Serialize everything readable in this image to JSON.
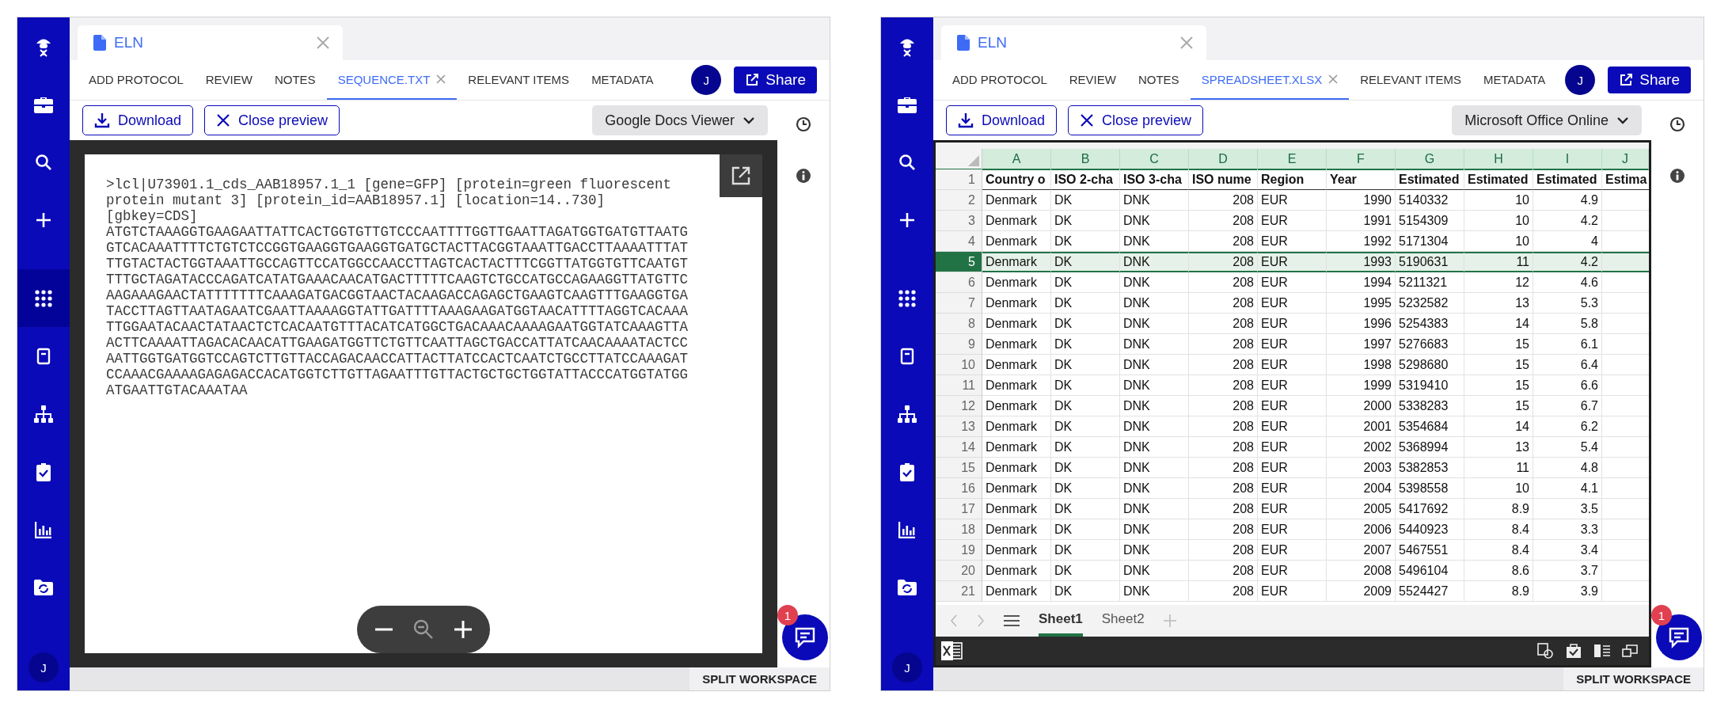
{
  "panels": [
    {
      "kind": "text",
      "sidebar": {
        "items": [
          {
            "kind": "logo",
            "selected": false
          },
          {
            "kind": "briefcase",
            "selected": false
          },
          {
            "kind": "search",
            "selected": false
          },
          {
            "kind": "plus",
            "selected": false
          },
          {
            "kind": "grid",
            "selected": true
          },
          {
            "kind": "tablet",
            "selected": false
          },
          {
            "kind": "hierarchy",
            "selected": false
          },
          {
            "kind": "clipboard",
            "selected": false
          },
          {
            "kind": "chart",
            "selected": false
          },
          {
            "kind": "folder",
            "selected": false
          }
        ],
        "avatar": "J"
      },
      "doc_tab": {
        "title": "ELN"
      },
      "nav_tabs": [
        {
          "label": "ADD PROTOCOL",
          "selected": false,
          "closable": false
        },
        {
          "label": "REVIEW",
          "selected": false,
          "closable": false
        },
        {
          "label": "NOTES",
          "selected": false,
          "closable": false
        },
        {
          "label": "SEQUENCE.TXT",
          "selected": true,
          "closable": true
        },
        {
          "label": "RELEVANT ITEMS",
          "selected": false,
          "closable": false
        },
        {
          "label": "METADATA",
          "selected": false,
          "closable": false
        }
      ],
      "user_avatar": "J",
      "share": "Share",
      "toolbar": {
        "download": "Download",
        "close_preview": "Close preview",
        "viewer": "Google Docs Viewer"
      },
      "viewer": {
        "lines": [
          ">lcl|U73901.1_cds_AAB18957.1_1 [gene=GFP] [protein=green fluorescent",
          "protein mutant 3] [protein_id=AAB18957.1] [location=14..730]",
          "[gbkey=CDS]",
          "ATGTCTAAAGGTGAAGAATTATTCACTGGTGTTGTCCCAATTTTGGTTGAATTAGATGGTGATGTTAATG",
          "GTCACAAATTTTCTGTCTCCGGTGAAGGTGAAGGTGATGCTACTTACGGTAAATTGACCTTAAAATTTAT",
          "TTGTACTACTGGTAAATTGCCAGTTCCATGGCCAACCTTAGTCACTACTTTCGGTTATGGTGTTCAATGT",
          "TTTGCTAGATACCCAGATCATATGAAACAACATGACTTTTTCAAGTCTGCCATGCCAGAAGGTTATGTTC",
          "AAGAAAGAACTATTTTTTTCAAAGATGACGGTAACTACAAGACCAGAGCTGAAGTCAAGTTTGAAGGTGA",
          "TACCTTAGTTAATAGAATCGAATTAAAAGGTATTGATTTTAAAGAAGATGGTAACATTTTAGGTCACAAA",
          "TTGGAATACAACTATAACTCTCACAATGTTTACATCATGGCTGACAAACAAAAGAATGGTATCAAAGTTA",
          "ACTTCAAAATTAGACACAACATTGAAGATGGTTCTGTTCAATTAGCTGACCATTATCAACAAAATACTCC",
          "AATTGGTGATGGTCCAGTCTTGTTACCAGACAACCATTACTTATCCACTCAATCTGCCTTATCCAAAGAT",
          "CCAAACGAAAAGAGAGACCACATGGTCTTGTTAGAATTTGTTACTGCTGCTGGTATTACCCATGGTATGG",
          "ATGAATTGTACAAATAA"
        ]
      },
      "chat_badge": "1",
      "split": "SPLIT WORKSPACE"
    },
    {
      "kind": "sheet",
      "sidebar": {
        "items": [
          {
            "kind": "logo",
            "selected": false
          },
          {
            "kind": "briefcase",
            "selected": false
          },
          {
            "kind": "search",
            "selected": false
          },
          {
            "kind": "plus",
            "selected": false
          },
          {
            "kind": "grid",
            "selected": false
          },
          {
            "kind": "tablet",
            "selected": false
          },
          {
            "kind": "hierarchy",
            "selected": false
          },
          {
            "kind": "clipboard",
            "selected": false
          },
          {
            "kind": "chart",
            "selected": false
          },
          {
            "kind": "folder",
            "selected": false
          }
        ],
        "avatar": "J"
      },
      "doc_tab": {
        "title": "ELN"
      },
      "nav_tabs": [
        {
          "label": "ADD PROTOCOL",
          "selected": false,
          "closable": false
        },
        {
          "label": "REVIEW",
          "selected": false,
          "closable": false
        },
        {
          "label": "NOTES",
          "selected": false,
          "closable": false
        },
        {
          "label": "SPREADSHEET.XLSX",
          "selected": true,
          "closable": true
        },
        {
          "label": "RELEVANT ITEMS",
          "selected": false,
          "closable": false
        },
        {
          "label": "METADATA",
          "selected": false,
          "closable": false
        }
      ],
      "user_avatar": "J",
      "share": "Share",
      "toolbar": {
        "download": "Download",
        "close_preview": "Close preview",
        "viewer": "Microsoft Office Online"
      },
      "viewer": {
        "columns": [
          {
            "letter": "A",
            "numeric": false
          },
          {
            "letter": "B",
            "numeric": false
          },
          {
            "letter": "C",
            "numeric": false
          },
          {
            "letter": "D",
            "numeric": true
          },
          {
            "letter": "E",
            "numeric": false
          },
          {
            "letter": "F",
            "numeric": true
          },
          {
            "letter": "G",
            "numeric": false
          },
          {
            "letter": "H",
            "numeric": true
          },
          {
            "letter": "I",
            "numeric": true
          },
          {
            "letter": "J",
            "numeric": false
          }
        ],
        "rows": [
          {
            "number": "1",
            "selected": false,
            "header": true,
            "cells": [
              "Country o",
              "ISO 2-cha",
              "ISO 3-cha",
              "ISO nume",
              "Region",
              "Year",
              "Estimated",
              "Estimated",
              "Estimated",
              "Estima"
            ]
          },
          {
            "number": "2",
            "selected": false,
            "header": false,
            "cells": [
              "Denmark",
              "DK",
              "DNK",
              "208",
              "EUR",
              "1990",
              "5140332",
              "10",
              "4.9"
            ]
          },
          {
            "number": "3",
            "selected": false,
            "header": false,
            "cells": [
              "Denmark",
              "DK",
              "DNK",
              "208",
              "EUR",
              "1991",
              "5154309",
              "10",
              "4.2"
            ]
          },
          {
            "number": "4",
            "selected": false,
            "header": false,
            "cells": [
              "Denmark",
              "DK",
              "DNK",
              "208",
              "EUR",
              "1992",
              "5171304",
              "10",
              "4"
            ]
          },
          {
            "number": "5",
            "selected": true,
            "header": false,
            "cells": [
              "Denmark",
              "DK",
              "DNK",
              "208",
              "EUR",
              "1993",
              "5190631",
              "11",
              "4.2"
            ]
          },
          {
            "number": "6",
            "selected": false,
            "header": false,
            "cells": [
              "Denmark",
              "DK",
              "DNK",
              "208",
              "EUR",
              "1994",
              "5211321",
              "12",
              "4.6"
            ]
          },
          {
            "number": "7",
            "selected": false,
            "header": false,
            "cells": [
              "Denmark",
              "DK",
              "DNK",
              "208",
              "EUR",
              "1995",
              "5232582",
              "13",
              "5.3"
            ]
          },
          {
            "number": "8",
            "selected": false,
            "header": false,
            "cells": [
              "Denmark",
              "DK",
              "DNK",
              "208",
              "EUR",
              "1996",
              "5254383",
              "14",
              "5.8"
            ]
          },
          {
            "number": "9",
            "selected": false,
            "header": false,
            "cells": [
              "Denmark",
              "DK",
              "DNK",
              "208",
              "EUR",
              "1997",
              "5276683",
              "15",
              "6.1"
            ]
          },
          {
            "number": "10",
            "selected": false,
            "header": false,
            "cells": [
              "Denmark",
              "DK",
              "DNK",
              "208",
              "EUR",
              "1998",
              "5298680",
              "15",
              "6.4"
            ]
          },
          {
            "number": "11",
            "selected": false,
            "header": false,
            "cells": [
              "Denmark",
              "DK",
              "DNK",
              "208",
              "EUR",
              "1999",
              "5319410",
              "15",
              "6.6"
            ]
          },
          {
            "number": "12",
            "selected": false,
            "header": false,
            "cells": [
              "Denmark",
              "DK",
              "DNK",
              "208",
              "EUR",
              "2000",
              "5338283",
              "15",
              "6.7"
            ]
          },
          {
            "number": "13",
            "selected": false,
            "header": false,
            "cells": [
              "Denmark",
              "DK",
              "DNK",
              "208",
              "EUR",
              "2001",
              "5354684",
              "14",
              "6.2"
            ]
          },
          {
            "number": "14",
            "selected": false,
            "header": false,
            "cells": [
              "Denmark",
              "DK",
              "DNK",
              "208",
              "EUR",
              "2002",
              "5368994",
              "13",
              "5.4"
            ]
          },
          {
            "number": "15",
            "selected": false,
            "header": false,
            "cells": [
              "Denmark",
              "DK",
              "DNK",
              "208",
              "EUR",
              "2003",
              "5382853",
              "11",
              "4.8"
            ]
          },
          {
            "number": "16",
            "selected": false,
            "header": false,
            "cells": [
              "Denmark",
              "DK",
              "DNK",
              "208",
              "EUR",
              "2004",
              "5398558",
              "10",
              "4.1"
            ]
          },
          {
            "number": "17",
            "selected": false,
            "header": false,
            "cells": [
              "Denmark",
              "DK",
              "DNK",
              "208",
              "EUR",
              "2005",
              "5417692",
              "8.9",
              "3.5"
            ]
          },
          {
            "number": "18",
            "selected": false,
            "header": false,
            "cells": [
              "Denmark",
              "DK",
              "DNK",
              "208",
              "EUR",
              "2006",
              "5440923",
              "8.4",
              "3.3"
            ]
          },
          {
            "number": "19",
            "selected": false,
            "header": false,
            "cells": [
              "Denmark",
              "DK",
              "DNK",
              "208",
              "EUR",
              "2007",
              "5467551",
              "8.4",
              "3.4"
            ]
          },
          {
            "number": "20",
            "selected": false,
            "header": false,
            "cells": [
              "Denmark",
              "DK",
              "DNK",
              "208",
              "EUR",
              "2008",
              "5496104",
              "8.6",
              "3.7"
            ]
          },
          {
            "number": "21",
            "selected": false,
            "header": false,
            "cells": [
              "Denmark",
              "DK",
              "DNK",
              "208",
              "EUR",
              "2009",
              "5524427",
              "8.9",
              "3.9"
            ]
          }
        ],
        "sheets": [
          {
            "label": "Sheet1",
            "selected": true
          },
          {
            "label": "Sheet2",
            "selected": false
          }
        ]
      },
      "chat_badge": "1",
      "split": "SPLIT WORKSPACE"
    }
  ]
}
